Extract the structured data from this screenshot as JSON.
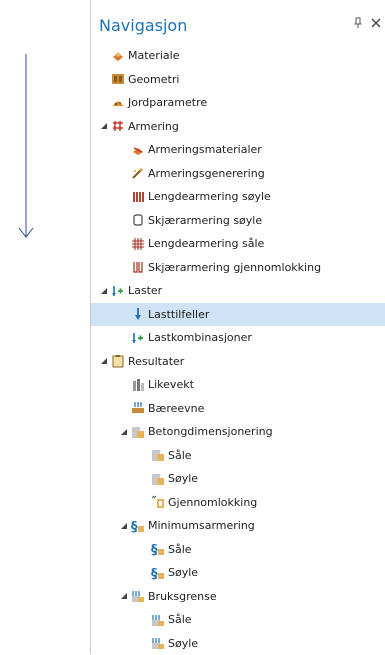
{
  "panel": {
    "title": "Navigasjon",
    "pin_icon": "pin-icon",
    "close_icon": "close-icon"
  },
  "tree": {
    "materiale": "Materiale",
    "geometri": "Geometri",
    "jordparametre": "Jordparametre",
    "armering": {
      "label": "Armering",
      "children": [
        "Armeringsmaterialer",
        "Armeringsgenerering",
        "Lengdearmering søyle",
        "Skjærarmering søyle",
        "Lengdearmering såle",
        "Skjærarmering gjennomlokking"
      ]
    },
    "laster": {
      "label": "Laster",
      "children": [
        "Lasttilfeller",
        "Lastkombinasjoner"
      ],
      "selected": "Lasttilfeller"
    },
    "resultater": {
      "label": "Resultater",
      "likevekt": "Likevekt",
      "baereevne": "Bæreevne",
      "betongdimensjonering": {
        "label": "Betongdimensjonering",
        "children": [
          "Såle",
          "Søyle",
          "Gjennomlokking"
        ]
      },
      "minimumsarmering": {
        "label": "Minimumsarmering",
        "children": [
          "Såle",
          "Søyle"
        ]
      },
      "bruksgrense": {
        "label": "Bruksgrense",
        "children": [
          "Såle",
          "Søyle"
        ]
      }
    }
  },
  "colors": {
    "accent": "#1e72b8",
    "selected_row": "#cfe3f4",
    "border": "#c8c8c8"
  }
}
